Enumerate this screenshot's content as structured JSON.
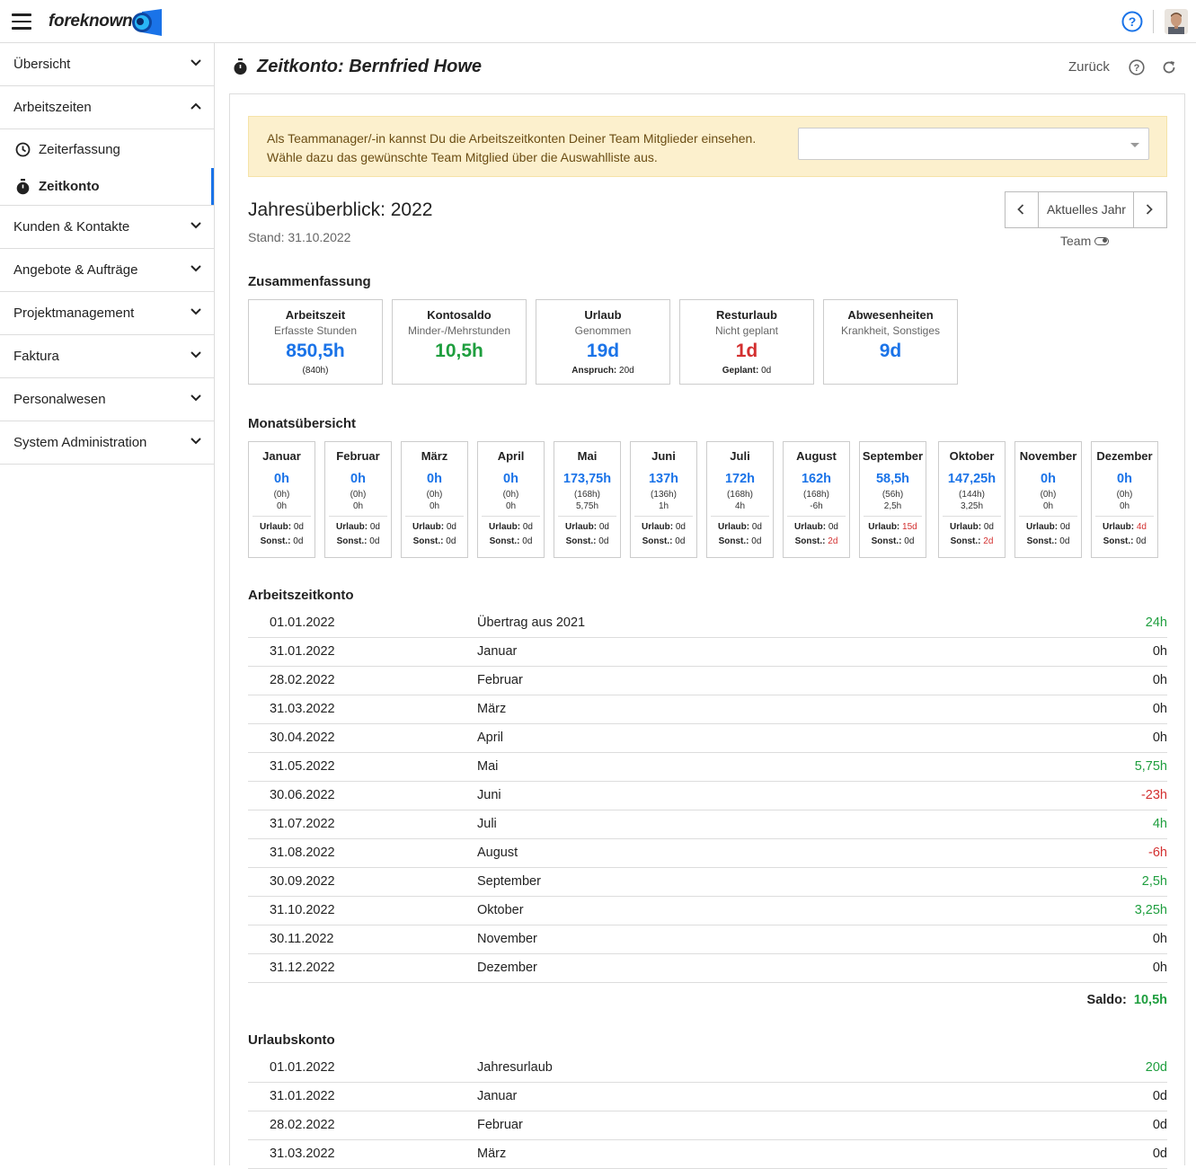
{
  "app": {
    "logo_text": "foreknown"
  },
  "sidebar": {
    "items": [
      {
        "label": "Übersicht"
      },
      {
        "label": "Arbeitszeiten"
      },
      {
        "label": "Kunden & Kontakte"
      },
      {
        "label": "Angebote & Aufträge"
      },
      {
        "label": "Projektmanagement"
      },
      {
        "label": "Faktura"
      },
      {
        "label": "Personalwesen"
      },
      {
        "label": "System Administration"
      }
    ],
    "sub_items": [
      {
        "label": "Zeiterfassung"
      },
      {
        "label": "Zeitkonto"
      }
    ]
  },
  "header": {
    "title": "Zeitkonto:  Bernfried Howe",
    "back_label": "Zurück"
  },
  "alert": {
    "text": "Als Teammanager/-in kannst Du die Arbeitszeitkonten Deiner Team Mitglieder einsehen. Wähle dazu das gewünschte Team Mitglied über die Auswahlliste aus.",
    "select_value": ""
  },
  "overview": {
    "title": "Jahresüberblick:  2022",
    "stand": "Stand: 31.10.2022",
    "current_year_label": "Aktuelles Jahr",
    "team_label": "Team"
  },
  "summary": {
    "title": "Zusammenfassung",
    "boxes": [
      {
        "head": "Arbeitszeit",
        "sub": "Erfasste Stunden",
        "value": "850,5h",
        "foot": "(840h)",
        "foot_label": ""
      },
      {
        "head": "Kontosaldo",
        "sub": "Minder-/Mehrstunden",
        "value": "10,5h",
        "foot": "",
        "foot_label": ""
      },
      {
        "head": "Urlaub",
        "sub": "Genommen",
        "value": "19d",
        "foot": "20d",
        "foot_label": "Anspruch:"
      },
      {
        "head": "Resturlaub",
        "sub": "Nicht geplant",
        "value": "1d",
        "foot": "0d",
        "foot_label": "Geplant:"
      },
      {
        "head": "Abwesenheiten",
        "sub": "Krankheit, Sonstiges",
        "value": "9d",
        "foot": "",
        "foot_label": ""
      }
    ],
    "colors": {
      "blue": "#1a73e8",
      "green": "#1e9e3e",
      "red": "#d32f2f"
    }
  },
  "monthly": {
    "title": "Monatsübersicht",
    "urlaub_label": "Urlaub:",
    "sonst_label": "Sonst.:",
    "months": [
      {
        "name": "Januar",
        "hours": "0h",
        "target": "(0h)",
        "diff": "0h",
        "urlaub": "0d",
        "sonst": "0d"
      },
      {
        "name": "Februar",
        "hours": "0h",
        "target": "(0h)",
        "diff": "0h",
        "urlaub": "0d",
        "sonst": "0d"
      },
      {
        "name": "März",
        "hours": "0h",
        "target": "(0h)",
        "diff": "0h",
        "urlaub": "0d",
        "sonst": "0d"
      },
      {
        "name": "April",
        "hours": "0h",
        "target": "(0h)",
        "diff": "0h",
        "urlaub": "0d",
        "sonst": "0d"
      },
      {
        "name": "Mai",
        "hours": "173,75h",
        "target": "(168h)",
        "diff": "5,75h",
        "urlaub": "0d",
        "sonst": "0d"
      },
      {
        "name": "Juni",
        "hours": "137h",
        "target": "(136h)",
        "diff": "1h",
        "urlaub": "0d",
        "sonst": "0d"
      },
      {
        "name": "Juli",
        "hours": "172h",
        "target": "(168h)",
        "diff": "4h",
        "urlaub": "0d",
        "sonst": "0d"
      },
      {
        "name": "August",
        "hours": "162h",
        "target": "(168h)",
        "diff": "-6h",
        "urlaub": "0d",
        "sonst": "2d"
      },
      {
        "name": "September",
        "hours": "58,5h",
        "target": "(56h)",
        "diff": "2,5h",
        "urlaub": "15d",
        "sonst": "0d"
      },
      {
        "name": "Oktober",
        "hours": "147,25h",
        "target": "(144h)",
        "diff": "3,25h",
        "urlaub": "0d",
        "sonst": "2d"
      },
      {
        "name": "November",
        "hours": "0h",
        "target": "(0h)",
        "diff": "0h",
        "urlaub": "0d",
        "sonst": "0d"
      },
      {
        "name": "Dezember",
        "hours": "0h",
        "target": "(0h)",
        "diff": "0h",
        "urlaub": "4d",
        "sonst": "0d"
      }
    ]
  },
  "arbeitszeitkonto": {
    "title": "Arbeitszeitkonto",
    "rows": [
      {
        "date": "01.01.2022",
        "text": "Übertrag aus 2021",
        "value": "24h"
      },
      {
        "date": "31.01.2022",
        "text": "Januar",
        "value": "0h"
      },
      {
        "date": "28.02.2022",
        "text": "Februar",
        "value": "0h"
      },
      {
        "date": "31.03.2022",
        "text": "März",
        "value": "0h"
      },
      {
        "date": "30.04.2022",
        "text": "April",
        "value": "0h"
      },
      {
        "date": "31.05.2022",
        "text": "Mai",
        "value": "5,75h"
      },
      {
        "date": "30.06.2022",
        "text": "Juni",
        "value": "-23h"
      },
      {
        "date": "31.07.2022",
        "text": "Juli",
        "value": "4h"
      },
      {
        "date": "31.08.2022",
        "text": "August",
        "value": "-6h"
      },
      {
        "date": "30.09.2022",
        "text": "September",
        "value": "2,5h"
      },
      {
        "date": "31.10.2022",
        "text": "Oktober",
        "value": "3,25h"
      },
      {
        "date": "30.11.2022",
        "text": "November",
        "value": "0h"
      },
      {
        "date": "31.12.2022",
        "text": "Dezember",
        "value": "0h"
      }
    ],
    "saldo_label": "Saldo:",
    "saldo_value": "10,5h"
  },
  "urlaubskonto": {
    "title": "Urlaubskonto",
    "rows": [
      {
        "date": "01.01.2022",
        "text": "Jahresurlaub",
        "value": "20d"
      },
      {
        "date": "31.01.2022",
        "text": "Januar",
        "value": "0d"
      },
      {
        "date": "28.02.2022",
        "text": "Februar",
        "value": "0d"
      },
      {
        "date": "31.03.2022",
        "text": "März",
        "value": "0d"
      }
    ]
  }
}
